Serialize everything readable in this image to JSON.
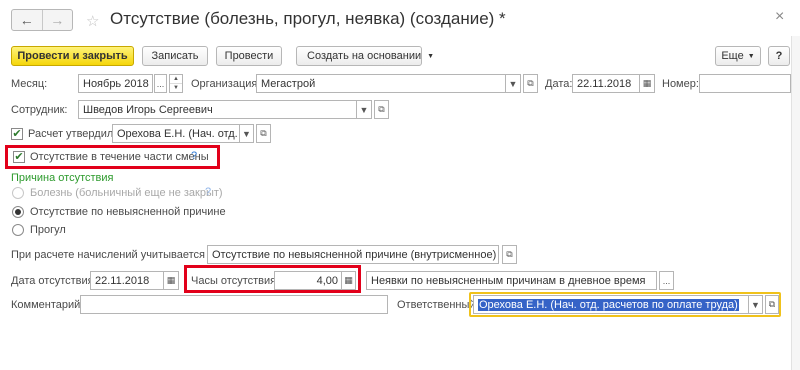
{
  "window": {
    "title": "Отсутствие (болезнь, прогул, неявка) (создание) *",
    "back_icon": "←",
    "forward_icon": "→",
    "star_icon": "☆",
    "close_icon": "×"
  },
  "toolbar": {
    "post_and_close": "Провести и закрыть",
    "save": "Записать",
    "post": "Провести",
    "create_based_on": "Создать на основании",
    "more": "Еще",
    "help": "?"
  },
  "form": {
    "month_label": "Месяц:",
    "month_value": "Ноябрь 2018",
    "org_label": "Организация:",
    "org_value": "Мегастрой",
    "date_label": "Дата:",
    "date_value": "22.11.2018",
    "number_label": "Номер:",
    "number_value": "",
    "employee_label": "Сотрудник:",
    "employee_value": "Шведов Игорь Сергеевич",
    "approved_label": "Расчет утвердил",
    "approved_checked": true,
    "approved_value": "Орехова Е.Н. (Нач. отд. ра",
    "partial_shift_label": "Отсутствие в течение части смены",
    "partial_shift_checked": true,
    "reason_header": "Причина отсутствия",
    "reason_sick": "Болезнь (больничный еще не закрыт)",
    "reason_unexplained": "Отсутствие по невыясненной причине",
    "reason_truancy": "Прогул",
    "selected_reason": "reason_unexplained",
    "accruals_label": "При расчете начислений учитывается как:",
    "accruals_value": "Отсутствие по невыясненной причине (внутрисменное)",
    "absence_date_label": "Дата отсутствия:",
    "absence_date_value": "22.11.2018",
    "hours_label": "Часы отсутствия:",
    "hours_value": "4,00",
    "daytime_value": "Неявки по невыясненным причинам в дневное время",
    "comment_label": "Комментарий:",
    "comment_value": "",
    "responsible_label": "Ответственный:",
    "responsible_value": "Орехова Е.Н. (Нач. отд. расчетов по оплате труда)"
  },
  "colors": {
    "primary_button": "#f5d60a",
    "highlight_box": "#e2001a",
    "section_header": "#2c9a2c",
    "help_icon": "#2f7bd6",
    "focus_border": "#f0c21b",
    "selection": "#3563c7"
  }
}
